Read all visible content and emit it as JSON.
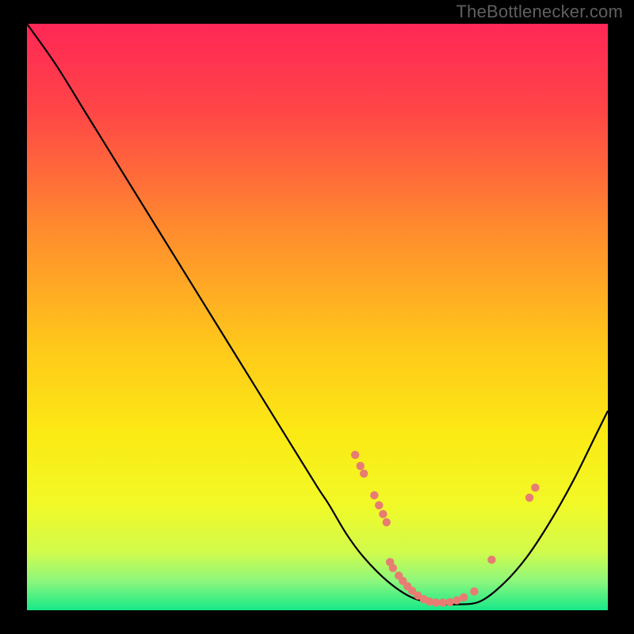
{
  "attribution": "TheBottlenecker.com",
  "chart_data": {
    "type": "line",
    "title": "",
    "xlabel": "",
    "ylabel": "",
    "xlim": [
      0,
      100
    ],
    "ylim": [
      0,
      100
    ],
    "background_gradient": {
      "stops": [
        {
          "offset": 0.0,
          "color": "#ff2756"
        },
        {
          "offset": 0.15,
          "color": "#ff4647"
        },
        {
          "offset": 0.35,
          "color": "#ff8b2e"
        },
        {
          "offset": 0.55,
          "color": "#ffc81a"
        },
        {
          "offset": 0.7,
          "color": "#fbea14"
        },
        {
          "offset": 0.82,
          "color": "#f1f927"
        },
        {
          "offset": 0.9,
          "color": "#d2fb4b"
        },
        {
          "offset": 0.95,
          "color": "#8df77c"
        },
        {
          "offset": 1.0,
          "color": "#17e989"
        }
      ]
    },
    "series": [
      {
        "name": "curve",
        "type": "line",
        "color": "#000000",
        "x": [
          0,
          5,
          10,
          15,
          20,
          25,
          30,
          35,
          40,
          45,
          50,
          52,
          55,
          58,
          62,
          66,
          70,
          74,
          78,
          82,
          86,
          90,
          94,
          98,
          100
        ],
        "y": [
          100,
          93,
          85,
          77,
          69,
          61,
          53,
          45,
          37,
          29,
          21,
          18,
          13,
          9,
          5,
          2.3,
          1.2,
          1.0,
          1.5,
          4.5,
          9,
          15,
          22,
          30,
          34
        ]
      },
      {
        "name": "markers",
        "type": "scatter",
        "color": "#e77d72",
        "points": [
          {
            "x": 56.5,
            "y": 26.5
          },
          {
            "x": 57.4,
            "y": 24.6
          },
          {
            "x": 58.0,
            "y": 23.3
          },
          {
            "x": 59.8,
            "y": 19.6
          },
          {
            "x": 60.6,
            "y": 17.9
          },
          {
            "x": 61.3,
            "y": 16.4
          },
          {
            "x": 61.9,
            "y": 15.0
          },
          {
            "x": 62.5,
            "y": 8.2
          },
          {
            "x": 63.0,
            "y": 7.2
          },
          {
            "x": 64.0,
            "y": 5.9
          },
          {
            "x": 64.7,
            "y": 5.0
          },
          {
            "x": 65.5,
            "y": 4.1
          },
          {
            "x": 66.3,
            "y": 3.3
          },
          {
            "x": 67.3,
            "y": 2.5
          },
          {
            "x": 68.3,
            "y": 1.9
          },
          {
            "x": 69.3,
            "y": 1.5
          },
          {
            "x": 70.4,
            "y": 1.3
          },
          {
            "x": 71.6,
            "y": 1.3
          },
          {
            "x": 72.8,
            "y": 1.4
          },
          {
            "x": 74.0,
            "y": 1.7
          },
          {
            "x": 75.2,
            "y": 2.2
          },
          {
            "x": 77.0,
            "y": 3.2
          },
          {
            "x": 80.0,
            "y": 8.6
          },
          {
            "x": 86.5,
            "y": 19.2
          },
          {
            "x": 87.5,
            "y": 20.9
          }
        ]
      }
    ]
  }
}
